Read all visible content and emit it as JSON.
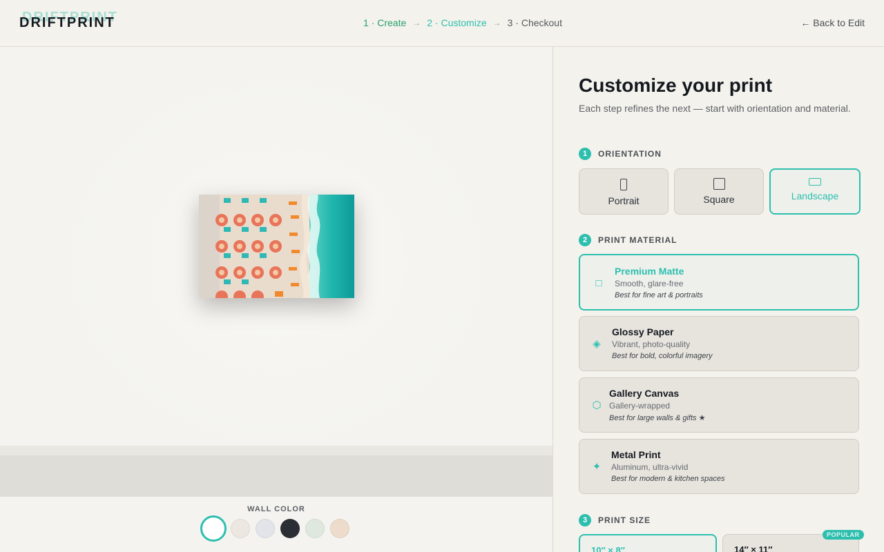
{
  "header": {
    "logo": "DRIFTPRINT",
    "steps": [
      {
        "label": "1 · Create"
      },
      {
        "label": "2 · Customize"
      },
      {
        "label": "3 · Checkout"
      }
    ],
    "step_arrow": "→",
    "back_link": "← Back to Edit"
  },
  "preview": {
    "wall_color_label": "WALL COLOR",
    "wall_colors": [
      "#ffffff",
      "#ece7e0",
      "#e2e4ea",
      "#2b2e35",
      "#dfe8df",
      "#eddccb"
    ],
    "selected_wall_color_index": 0
  },
  "panel": {
    "title": "Customize your print",
    "subtitle": "Each step refines the next — start with orientation and material.",
    "orientation": {
      "num": "1",
      "label": "ORIENTATION",
      "options": [
        {
          "label": "Portrait",
          "icon": "portrait-icon"
        },
        {
          "label": "Square",
          "icon": "square-icon"
        },
        {
          "label": "Landscape",
          "icon": "landscape-icon"
        }
      ],
      "selected_index": 2
    },
    "material": {
      "num": "2",
      "label": "PRINT MATERIAL",
      "options": [
        {
          "title": "Premium Matte",
          "subtitle": "Smooth, glare-free",
          "best": "Best for fine art & portraits",
          "icon": "square-outline-icon",
          "glyph": "□"
        },
        {
          "title": "Glossy Paper",
          "subtitle": "Vibrant, photo-quality",
          "best": "Best for bold, colorful imagery",
          "icon": "diamond-icon",
          "glyph": "◈"
        },
        {
          "title": "Gallery Canvas",
          "subtitle": "Gallery-wrapped",
          "best": "Best for large walls & gifts ★",
          "icon": "hexagon-icon",
          "glyph": "⬡"
        },
        {
          "title": "Metal Print",
          "subtitle": "Aluminum, ultra-vivid",
          "best": "Best for modern & kitchen spaces",
          "icon": "sparkle-icon",
          "glyph": "✦"
        }
      ],
      "selected_index": 0
    },
    "size": {
      "num": "3",
      "label": "PRINT SIZE",
      "options": [
        {
          "label": "10″ × 8″"
        },
        {
          "label": "14″ × 11″",
          "badge": "POPULAR"
        }
      ],
      "selected_index": 0
    }
  },
  "colors": {
    "accent": "#2cbfae",
    "create_step": "#2aa06f"
  }
}
